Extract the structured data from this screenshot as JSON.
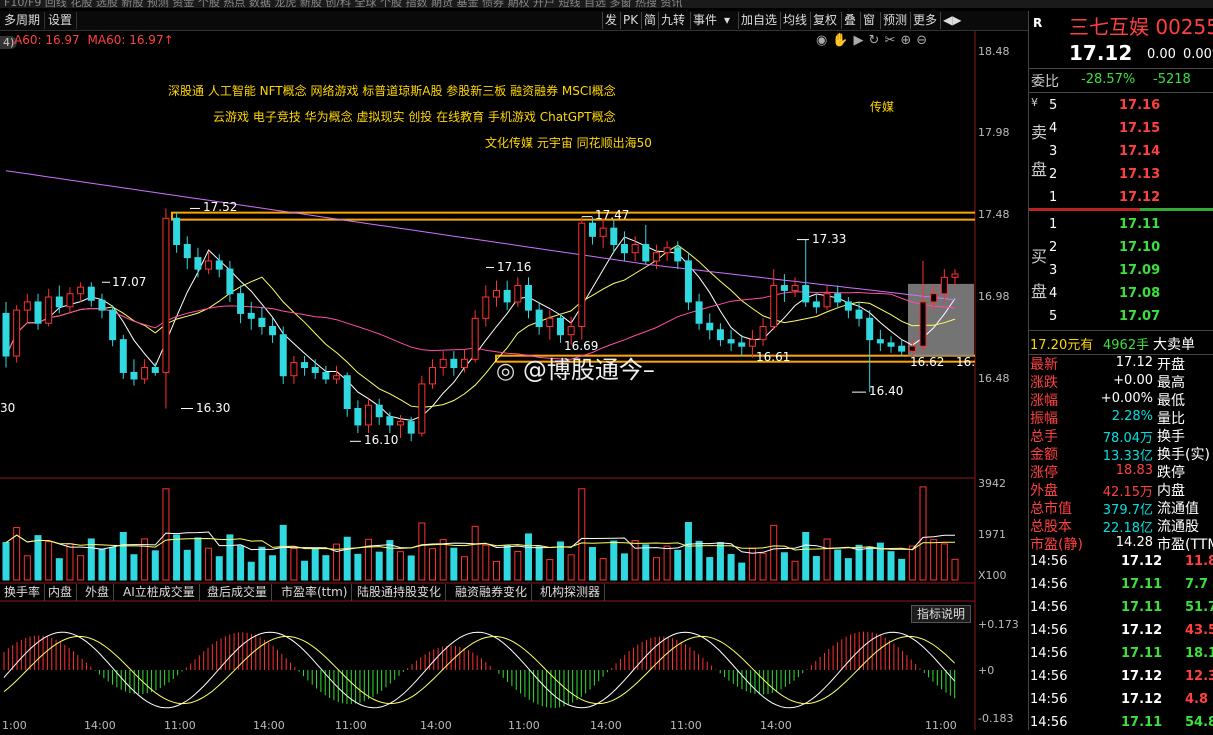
{
  "toolbar": {
    "left": [
      "多周期",
      "设置"
    ],
    "right": [
      "发",
      "PK",
      "简",
      "九转",
      "事件",
      "▾",
      "加自选",
      "均线",
      "复权",
      "叠",
      "窗",
      "预测",
      "更多",
      "◀▶"
    ]
  },
  "ma_line": {
    "ma_text": "A60: 16.97",
    "ma60_text": "MA60: 16.97↑"
  },
  "chart_number_label": "4)",
  "concepts": {
    "line1": "深股通  人工智能  NFT概念  网络游戏  标普道琼斯A股  参股新三板  融资融券  MSCI概念",
    "line2": "云游戏  电子竞技  华为概念  虚拟现实  创投  在线教育  手机游戏  ChatGPT概念",
    "line3": "文化传媒  元宇宙  同花顺出海50",
    "industry": "传媒"
  },
  "price_axis": [
    "18.48",
    "17.98",
    "17.48",
    "16.98",
    "16.48"
  ],
  "price_marks": {
    "p1752": "17.52",
    "p1747": "17.47",
    "p1733": "17.33",
    "p1716": "17.16",
    "p1707": "17.07",
    "p1669": "16.69",
    "p1661": "16.61",
    "p1662": "16.62",
    "p1630": "16.30",
    "p1640": "16.40",
    "p1610": "16.10",
    "left_cut": "30",
    "right_cut": "16."
  },
  "watermark": "@博股通今–",
  "volume_axis": [
    "3942",
    "1971",
    "X100"
  ],
  "tabs": [
    "换手率",
    "内盘",
    "外盘",
    "AI立桩成交量",
    "盘后成交量",
    "市盈率(ttm)",
    "陆股通持股变化",
    "融资融券变化",
    "机构探测器"
  ],
  "indicator_button": "指标说明",
  "macd_axis": [
    "+0.173",
    "+0",
    "-0.183"
  ],
  "time_labels": [
    "1:00",
    "14:00",
    "11:00",
    "14:00",
    "11:00",
    "14:00",
    "11:00",
    "14:00",
    "11:00",
    "14:00",
    "11:00"
  ],
  "stock": {
    "r": "R",
    "name": "三七互娱",
    "code": "00255",
    "price": "17.12",
    "change": "0.00",
    "pct": "0.00%"
  },
  "weibi": {
    "label": "委比",
    "pct": "-28.57%",
    "diff": "-5218"
  },
  "sell_side": {
    "label1": "卖",
    "label2": "盘",
    "yen": "¥",
    "rows": [
      {
        "n": "5",
        "price": "17.16"
      },
      {
        "n": "4",
        "price": "17.15"
      },
      {
        "n": "3",
        "price": "17.14"
      },
      {
        "n": "2",
        "price": "17.13"
      },
      {
        "n": "1",
        "price": "17.12"
      }
    ]
  },
  "buy_side": {
    "label1": "买",
    "label2": "盘",
    "rows": [
      {
        "n": "1",
        "price": "17.11"
      },
      {
        "n": "2",
        "price": "17.10"
      },
      {
        "n": "3",
        "price": "17.09"
      },
      {
        "n": "4",
        "price": "17.08"
      },
      {
        "n": "5",
        "price": "17.07"
      }
    ]
  },
  "big_order": {
    "price": "17.20元有",
    "qty": "4962手",
    "label": "大卖单"
  },
  "stats": [
    {
      "k1": "最新",
      "v": "17.12",
      "k2": "开盘",
      "c": "white"
    },
    {
      "k1": "涨跌",
      "v": "+0.00",
      "k2": "最高",
      "c": "white"
    },
    {
      "k1": "涨幅",
      "v": "+0.00%",
      "k2": "最低",
      "c": "white"
    },
    {
      "k1": "振幅",
      "v": "2.28%",
      "k2": "量比",
      "c": "cyan"
    },
    {
      "k1": "总手",
      "v": "78.04万",
      "k2": "换手",
      "c": "cyan"
    },
    {
      "k1": "金额",
      "v": "13.33亿",
      "k2": "换手(实)",
      "c": "cyan"
    },
    {
      "k1": "涨停",
      "v": "18.83",
      "k2": "跌停",
      "c": "red"
    },
    {
      "k1": "外盘",
      "v": "42.15万",
      "k2": "内盘",
      "c": "red"
    },
    {
      "k1": "总市值",
      "v": "379.7亿",
      "k2": "流通值",
      "c": "cyan"
    },
    {
      "k1": "总股本",
      "v": "22.18亿",
      "k2": "流通股",
      "c": "cyan"
    },
    {
      "k1": "市盈(静)",
      "v": "14.28",
      "k2": "市盈(TTM",
      "c": "white"
    }
  ],
  "ticks": [
    {
      "t": "14:56",
      "p": "17.12",
      "v": "11.8",
      "pc": "white",
      "vc": "red"
    },
    {
      "t": "14:56",
      "p": "17.11",
      "v": "7.7",
      "pc": "green",
      "vc": "green"
    },
    {
      "t": "14:56",
      "p": "17.11",
      "v": "51.7",
      "pc": "green",
      "vc": "green"
    },
    {
      "t": "14:56",
      "p": "17.12",
      "v": "43.5",
      "pc": "white",
      "vc": "red"
    },
    {
      "t": "14:56",
      "p": "17.11",
      "v": "18.1",
      "pc": "green",
      "vc": "green"
    },
    {
      "t": "14:56",
      "p": "17.12",
      "v": "12.3",
      "pc": "white",
      "vc": "red"
    },
    {
      "t": "14:56",
      "p": "17.12",
      "v": "4.8",
      "pc": "white",
      "vc": "red"
    },
    {
      "t": "14:56",
      "p": "17.11",
      "v": "54.8",
      "pc": "green",
      "vc": "green"
    }
  ],
  "chart_data": {
    "type": "candlestick",
    "price_range": [
      16.0,
      18.6
    ],
    "support_line": 16.61,
    "resistance_line": 17.47,
    "candles": [
      [
        16.88,
        16.62,
        16.95,
        16.55
      ],
      [
        16.62,
        16.9,
        16.93,
        16.58
      ],
      [
        16.9,
        16.95,
        17.0,
        16.82
      ],
      [
        16.95,
        16.82,
        17.0,
        16.78
      ],
      [
        16.82,
        16.98,
        17.03,
        16.8
      ],
      [
        16.98,
        16.92,
        17.05,
        16.88
      ],
      [
        16.92,
        17.0,
        17.04,
        16.88
      ],
      [
        17.0,
        17.04,
        17.07,
        16.95
      ],
      [
        17.04,
        16.96,
        17.07,
        16.92
      ],
      [
        16.96,
        16.9,
        17.0,
        16.85
      ],
      [
        16.9,
        16.72,
        16.93,
        16.68
      ],
      [
        16.72,
        16.52,
        16.75,
        16.48
      ],
      [
        16.52,
        16.48,
        16.6,
        16.44
      ],
      [
        16.48,
        16.55,
        16.6,
        16.45
      ],
      [
        16.55,
        16.52,
        16.58,
        16.5
      ],
      [
        16.52,
        17.46,
        17.52,
        16.3
      ],
      [
        17.46,
        17.3,
        17.5,
        17.25
      ],
      [
        17.3,
        17.22,
        17.35,
        17.15
      ],
      [
        17.22,
        17.15,
        17.28,
        17.1
      ],
      [
        17.15,
        17.2,
        17.26,
        17.12
      ],
      [
        17.2,
        17.15,
        17.24,
        17.1
      ],
      [
        17.15,
        17.0,
        17.2,
        16.95
      ],
      [
        17.0,
        16.88,
        17.05,
        16.82
      ],
      [
        16.88,
        16.85,
        16.95,
        16.78
      ],
      [
        16.85,
        16.8,
        16.92,
        16.75
      ],
      [
        16.8,
        16.75,
        16.85,
        16.7
      ],
      [
        16.75,
        16.5,
        16.8,
        16.45
      ],
      [
        16.5,
        16.58,
        16.62,
        16.45
      ],
      [
        16.58,
        16.55,
        16.62,
        16.5
      ],
      [
        16.55,
        16.52,
        16.6,
        16.48
      ],
      [
        16.52,
        16.48,
        16.56,
        16.45
      ],
      [
        16.48,
        16.5,
        16.56,
        16.45
      ],
      [
        16.5,
        16.3,
        16.52,
        16.25
      ],
      [
        16.3,
        16.2,
        16.35,
        16.15
      ],
      [
        16.2,
        16.32,
        16.36,
        16.15
      ],
      [
        16.32,
        16.25,
        16.36,
        16.2
      ],
      [
        16.25,
        16.2,
        16.28,
        16.15
      ],
      [
        16.2,
        16.22,
        16.26,
        16.12
      ],
      [
        16.22,
        16.15,
        16.25,
        16.1
      ],
      [
        16.15,
        16.45,
        16.5,
        16.13
      ],
      [
        16.45,
        16.55,
        16.6,
        16.42
      ],
      [
        16.55,
        16.6,
        16.65,
        16.5
      ],
      [
        16.6,
        16.55,
        16.65,
        16.5
      ],
      [
        16.55,
        16.6,
        16.66,
        16.52
      ],
      [
        16.6,
        16.85,
        16.9,
        16.58
      ],
      [
        16.85,
        16.98,
        17.05,
        16.8
      ],
      [
        16.98,
        17.02,
        17.08,
        16.92
      ],
      [
        17.02,
        16.95,
        17.08,
        16.9
      ],
      [
        16.95,
        17.05,
        17.1,
        16.92
      ],
      [
        17.05,
        16.9,
        17.1,
        16.85
      ],
      [
        16.9,
        16.8,
        16.95,
        16.75
      ],
      [
        16.8,
        16.85,
        16.9,
        16.72
      ],
      [
        16.85,
        16.75,
        16.88,
        16.7
      ],
      [
        16.75,
        16.8,
        16.86,
        16.69
      ],
      [
        16.8,
        17.43,
        17.47,
        16.72
      ],
      [
        17.43,
        17.35,
        17.47,
        17.3
      ],
      [
        17.35,
        17.4,
        17.46,
        17.28
      ],
      [
        17.4,
        17.3,
        17.45,
        17.25
      ],
      [
        17.3,
        17.25,
        17.38,
        17.2
      ],
      [
        17.25,
        17.3,
        17.35,
        17.2
      ],
      [
        17.3,
        17.2,
        17.42,
        17.18
      ],
      [
        17.2,
        17.25,
        17.3,
        17.15
      ],
      [
        17.25,
        17.28,
        17.32,
        17.2
      ],
      [
        17.28,
        17.2,
        17.32,
        17.15
      ],
      [
        17.2,
        16.95,
        17.25,
        16.9
      ],
      [
        16.95,
        16.82,
        17.0,
        16.78
      ],
      [
        16.82,
        16.78,
        16.88,
        16.72
      ],
      [
        16.78,
        16.72,
        16.82,
        16.68
      ],
      [
        16.72,
        16.7,
        16.78,
        16.65
      ],
      [
        16.7,
        16.68,
        16.75,
        16.62
      ],
      [
        16.68,
        16.72,
        16.78,
        16.61
      ],
      [
        16.72,
        16.8,
        16.85,
        16.68
      ],
      [
        16.8,
        17.05,
        17.15,
        16.78
      ],
      [
        17.05,
        17.02,
        17.12,
        16.95
      ],
      [
        17.02,
        17.05,
        17.1,
        16.98
      ],
      [
        17.05,
        16.95,
        17.33,
        16.92
      ],
      [
        16.95,
        16.92,
        17.0,
        16.88
      ],
      [
        16.92,
        17.0,
        17.05,
        16.9
      ],
      [
        17.0,
        16.95,
        17.05,
        16.92
      ],
      [
        16.95,
        16.9,
        16.98,
        16.85
      ],
      [
        16.9,
        16.85,
        16.95,
        16.8
      ],
      [
        16.85,
        16.72,
        16.9,
        16.4
      ],
      [
        16.72,
        16.7,
        16.78,
        16.65
      ],
      [
        16.7,
        16.68,
        16.74,
        16.64
      ],
      [
        16.68,
        16.65,
        16.72,
        16.62
      ],
      [
        16.65,
        16.68,
        16.72,
        16.62
      ],
      [
        16.68,
        16.95,
        17.2,
        16.65
      ],
      [
        16.95,
        17.0,
        17.05,
        16.9
      ],
      [
        17.0,
        17.1,
        17.15,
        16.95
      ],
      [
        17.1,
        17.12,
        17.15,
        17.05
      ]
    ]
  }
}
